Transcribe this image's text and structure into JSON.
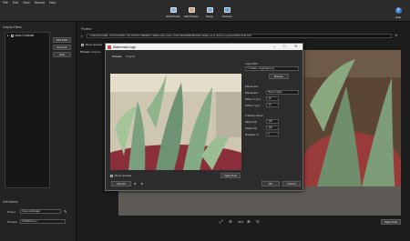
{
  "menu": [
    "File",
    "Edit",
    "View",
    "Wizard",
    "Help"
  ],
  "toolbar": {
    "add_photos": "Add Photos",
    "edit_photos": "Edit Photos",
    "setup": "Setup",
    "process": "Process",
    "help": "Help"
  },
  "left": {
    "title": "Graphic Filters",
    "filter_item": "Auto Contrast",
    "buttons": {
      "add": "Add Filter",
      "remove": "Remove",
      "edit": "Edit"
    },
    "edit_name": "Edit Names",
    "preset_label": "Preset",
    "preset_value": "Keep unchanged",
    "preview_label": "Preview",
    "preview_value": "P1000121.ext"
  },
  "main": {
    "preview_title": "Preview",
    "path": "C:\\DE-KIOKURE\\...\\AUTOSTATE\\>>\\IQ PHOTO PRESES>>\\Watermark Lower LOGO-WATERMARK\\Hide Padlan.ext to pictures organized\\DSC1234.JPG",
    "show_preview": "Show preview",
    "tab_preview": "Preview",
    "tab_original": "Original",
    "zoom_value": "28%",
    "apply_now": "Apply Now"
  },
  "dialog": {
    "title": "Watermark-Logo",
    "tab_preview": "Preview",
    "tab_original": "Original",
    "logo_path_label": "Logo Path",
    "logo_path_value": "C:\\Users\\...\\logo\\logo.png",
    "browse": "Browse",
    "placement_header": "Placement",
    "placement_label": "Placement",
    "placement_value": "Bottom Right",
    "offset_x_label": "Offset X (px)",
    "offset_x_value": "10",
    "offset_y_label": "Offset Y (px)",
    "offset_y_value": "10",
    "transform_header": "Transformation",
    "alpha_label": "Alpha (%)",
    "alpha_value": "100",
    "scale_label": "Scale (%)",
    "scale_value": "100",
    "rotation_label": "Rotation (°)",
    "rotation_value": "0",
    "show_preview": "Show preview",
    "apply_now": "Apply Now",
    "cancel_left": "Cancel",
    "ok": "OK",
    "cancel": "Cancel"
  }
}
